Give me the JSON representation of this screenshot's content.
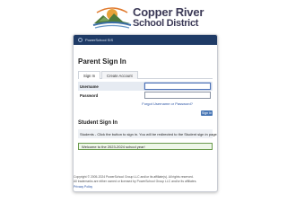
{
  "logo": {
    "line1": "Copper River",
    "line2": "School District",
    "icon": "mountains-sun-logo"
  },
  "header": {
    "title": "PowerSchool SIS",
    "icon": "powerschool-icon"
  },
  "parent": {
    "heading": "Parent Sign In",
    "tabs": [
      {
        "label": "Sign In"
      },
      {
        "label": "Create Account"
      }
    ],
    "username_label": "Username",
    "password_label": "Password",
    "username_value": "",
    "password_value": "",
    "forgot_link": "Forgot Username or Password?",
    "signin_button": "Sign In"
  },
  "student": {
    "heading": "Student Sign In",
    "text": "Students - Click the button to sign in. You will be redirected to the Student sign in page."
  },
  "welcome": "Welcome to the 2023-2024 school year!",
  "footer": {
    "line1": "Copyright © 2005-2024 PowerSchool Group LLC and/or its affiliate(s). All rights reserved.",
    "line2": "All trademarks are either owned or licensed by PowerSchool Group LLC and/or its affiliates.",
    "privacy": "Privacy Policy"
  },
  "colors": {
    "header_bg": "#1f3b66",
    "link": "#2952a3",
    "button": "#4a78b6",
    "logo_text": "#3c3a57",
    "welcome_border": "#6b9b4d"
  }
}
